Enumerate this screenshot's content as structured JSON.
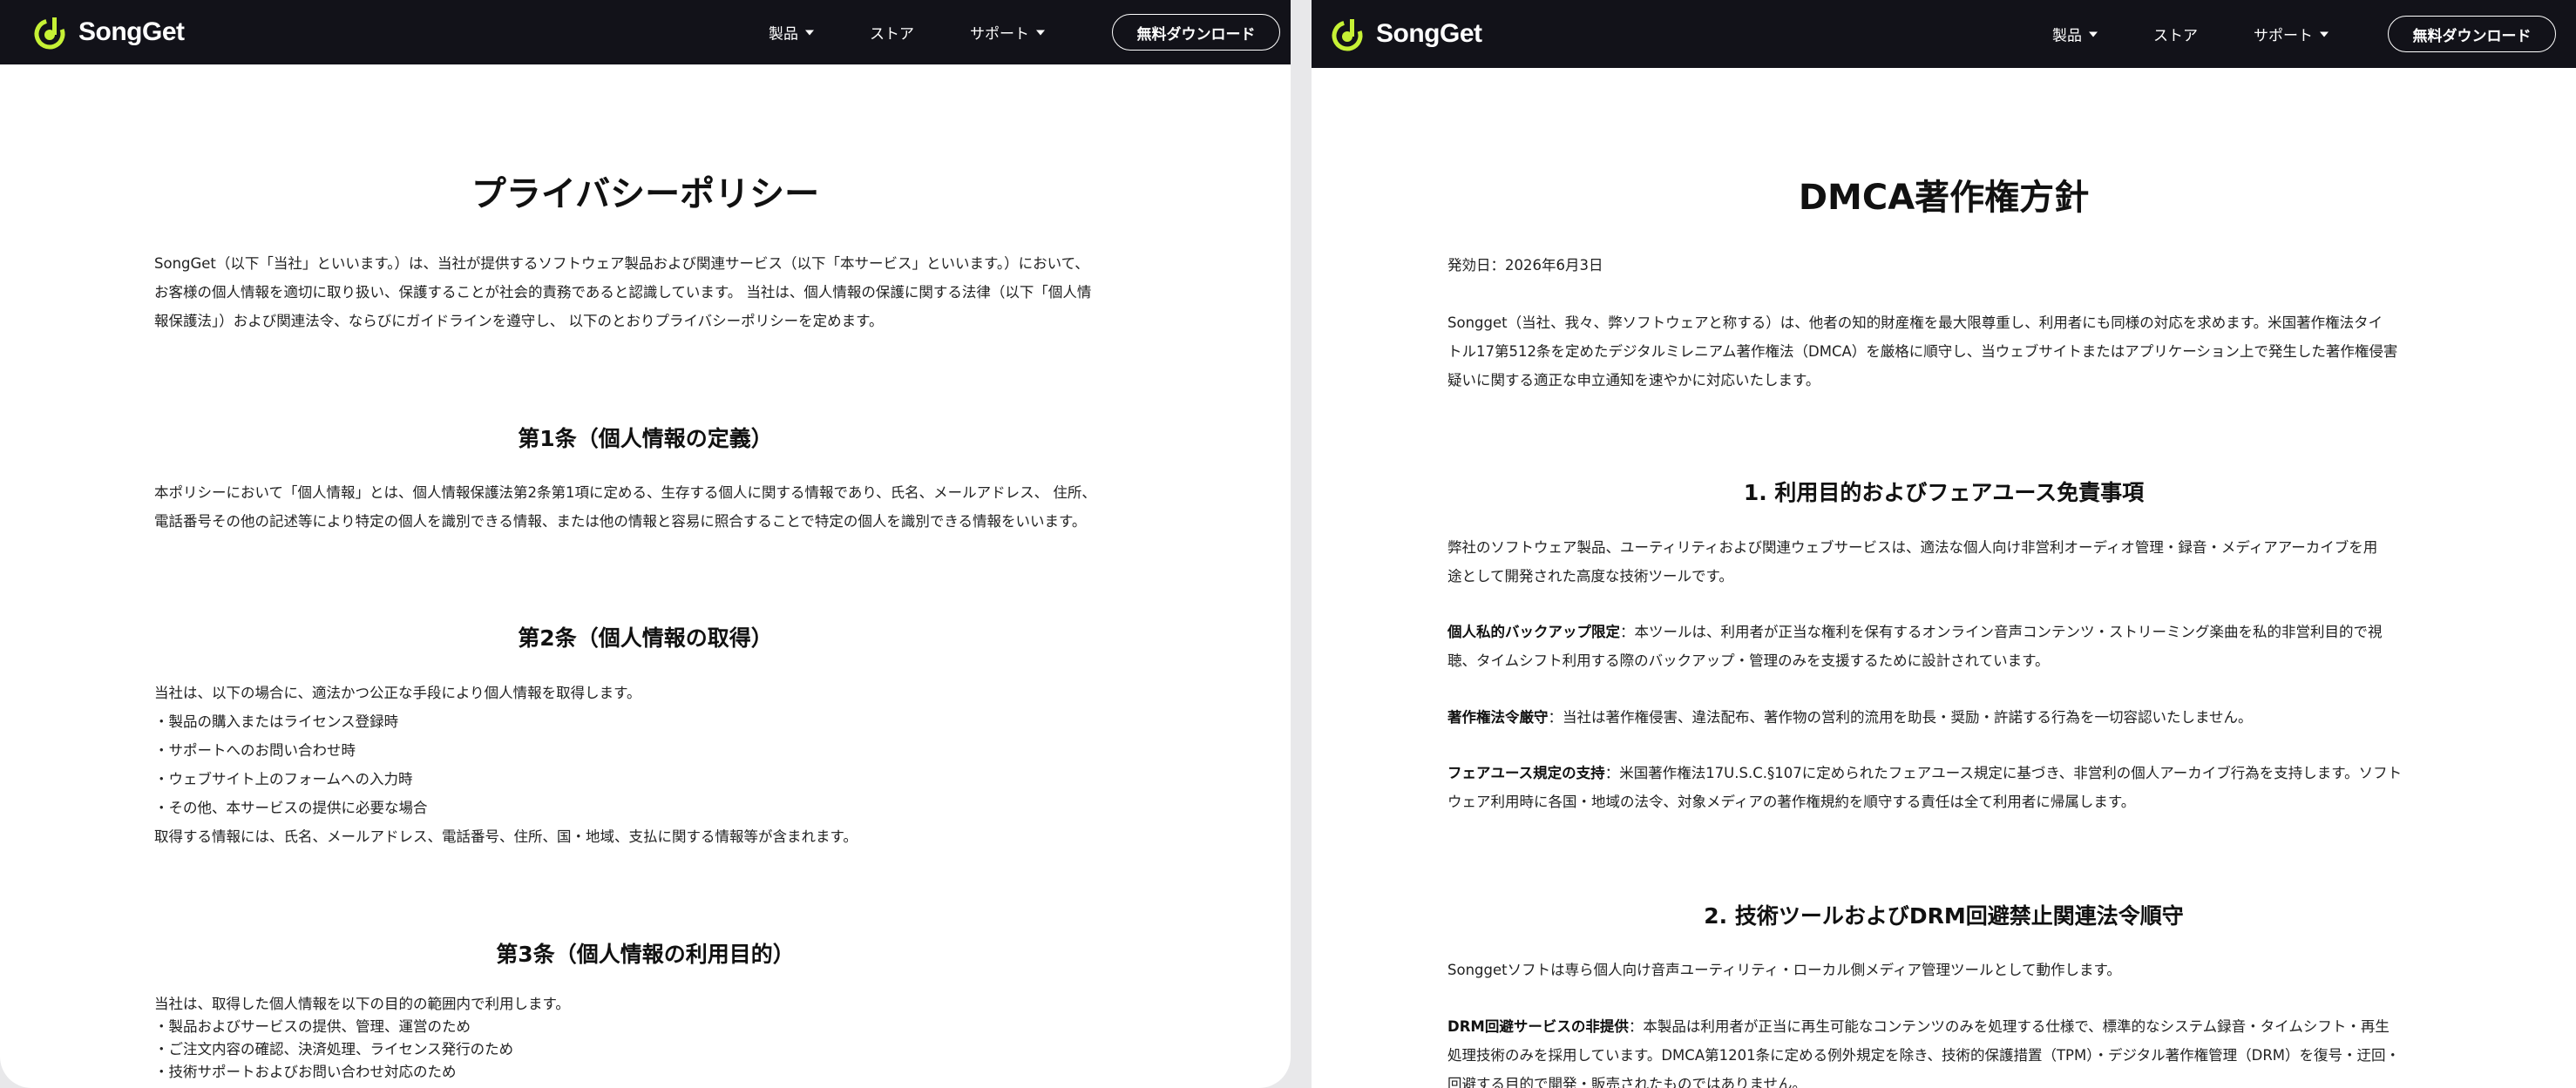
{
  "brand": {
    "name": "SongGet",
    "accent_color": "#c6f135",
    "nav_bg": "#121219"
  },
  "nav": {
    "products": "製品",
    "store": "ストア",
    "support": "サポート",
    "download": "無料ダウンロード"
  },
  "left": {
    "title": "プライバシーポリシー",
    "intro": [
      "SongGet（以下「当社」といいます。）は、当社が提供するソフトウェア製品および関連サービス（以下「本サービス」といいます。）において、",
      "お客様の個人情報を適切に取り扱い、保護することが社会的責務であると認識しています。 当社は、個人情報の保護に関する法律（以下「個人情",
      "報保護法」）および関連法令、ならびにガイドラインを遵守し、 以下のとおりプライバシーポリシーを定めます。"
    ],
    "art1": {
      "heading": "第1条（個人情報の定義）",
      "lines": [
        "本ポリシーにおいて「個人情報」とは、個人情報保護法第2条第1項に定める、生存する個人に関する情報であり、氏名、メールアドレス、 住所、",
        "電話番号その他の記述等により特定の個人を識別できる情報、または他の情報と容易に照合することで特定の個人を識別できる情報をいいます。"
      ]
    },
    "art2": {
      "heading": "第2条（個人情報の取得）",
      "lines": [
        "当社は、以下の場合に、適法かつ公正な手段により個人情報を取得します。",
        "・製品の購入またはライセンス登録時",
        "・サポートへのお問い合わせ時",
        "・ウェブサイト上のフォームへの入力時",
        "・その他、本サービスの提供に必要な場合",
        "取得する情報には、氏名、メールアドレス、電話番号、住所、国・地域、支払に関する情報等が含まれます。"
      ]
    },
    "art3": {
      "heading": "第3条（個人情報の利用目的）",
      "lines": [
        "当社は、取得した個人情報を以下の目的の範囲内で利用します。",
        "・製品およびサービスの提供、管理、運営のため",
        "・ご注文内容の確認、決済処理、ライセンス発行のため",
        "・技術サポートおよびお問い合わせ対応のため"
      ]
    }
  },
  "right": {
    "title": "DMCA著作権方針",
    "date": "発効日：2026年6月3日",
    "intro": [
      "Songget（当社、我々、弊ソフトウェアと称する）は、他者の知的財産権を最大限尊重し、利用者にも同様の対応を求めます。米国著作権法タイ",
      "トル17第512条を定めたデジタルミレニアム著作権法（DMCA）を厳格に順守し、当ウェブサイトまたはアプリケーション上で発生した著作権侵害",
      "疑いに関する適正な申立通知を速やかに対応いたします。"
    ],
    "sec1": {
      "heading": "1. 利用目的およびフェアユース免責事項",
      "p1": [
        "弊社のソフトウェア製品、ユーティリティおよび関連ウェブサービスは、適法な個人向け非営利オーディオ管理・録音・メディアアーカイブを用",
        "途として開発された高度な技術ツールです。"
      ],
      "p2_label": "個人私的バックアップ限定",
      "p2": [
        "：本ツールは、利用者が正当な権利を保有するオンライン音声コンテンツ・ストリーミング楽曲を私的非営利目的で視",
        "聴、タイムシフト利用する際のバックアップ・管理のみを支援するために設計されています。"
      ],
      "p3_label": "著作権法令厳守",
      "p3": "：当社は著作権侵害、違法配布、著作物の営利的流用を助長・奨励・許諾する行為を一切容認いたしません。",
      "p4_label": "フェアユース規定の支持",
      "p4": [
        "：米国著作権法17U.S.C.§107に定められたフェアユース規定に基づき、非営利の個人アーカイブ行為を支持します。ソフト",
        "ウェア利用時に各国・地域の法令、対象メディアの著作権規約を順守する責任は全て利用者に帰属します。"
      ]
    },
    "sec2": {
      "heading": "2. 技術ツールおよびDRM回避禁止関連法令順守",
      "p1": "Songgetソフトは専ら個人向け音声ユーティリティ・ローカル側メディア管理ツールとして動作します。",
      "p2_label": "DRM回避サービスの非提供",
      "p2": [
        "：本製品は利用者が正当に再生可能なコンテンツのみを処理する仕様で、標準的なシステム録音・タイムシフト・再生",
        "処理技術のみを採用しています。DMCA第1201条に定める例外規定を除き、技術的保護措置（TPM）・デジタル著作権管理（DRM）を復号・迂回・",
        "回避する目的で開発・販売されたものではありません。"
      ]
    }
  }
}
